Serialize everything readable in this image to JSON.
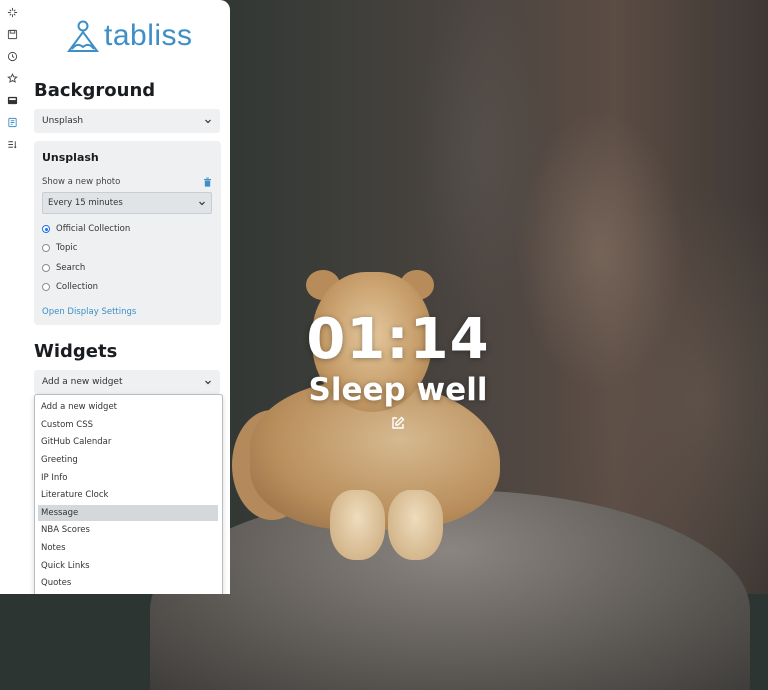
{
  "app": {
    "logo_text": "tabliss",
    "accent_color": "#3e8ec7"
  },
  "rail": {
    "icons": [
      "sparkle-icon",
      "save-icon",
      "clock-icon",
      "star-icon",
      "image-icon",
      "document-icon",
      "list-icon"
    ]
  },
  "background": {
    "heading": "Background",
    "select_value": "Unsplash",
    "card": {
      "title": "Unsplash",
      "show_new_photo_label": "Show a new photo",
      "interval_value": "Every 15 minutes",
      "options": [
        {
          "label": "Official Collection",
          "checked": true
        },
        {
          "label": "Topic",
          "checked": false
        },
        {
          "label": "Search",
          "checked": false
        },
        {
          "label": "Collection",
          "checked": false
        }
      ],
      "link": "Open Display Settings"
    }
  },
  "widgets": {
    "heading": "Widgets",
    "select_value": "Add a new widget",
    "dropdown_options": [
      "Add a new widget",
      "Custom CSS",
      "GitHub Calendar",
      "Greeting",
      "IP Info",
      "Literature Clock",
      "Message",
      "NBA Scores",
      "Notes",
      "Quick Links",
      "Quotes"
    ],
    "selected_option": "Message"
  },
  "dashboard": {
    "time": "01:14",
    "greeting": "Sleep well"
  }
}
